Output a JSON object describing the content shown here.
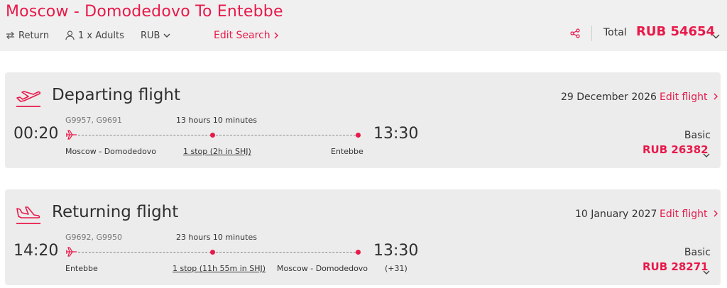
{
  "header": {
    "title": "Moscow - Domodedovo To Entebbe",
    "trip_type": "Return",
    "passengers": "1 x Adults",
    "currency": "RUB",
    "edit_search": "Edit Search",
    "total_label": "Total",
    "total_value": "RUB 54654"
  },
  "departing": {
    "title": "Departing flight",
    "date": "29 December 2026",
    "edit": "Edit flight",
    "flight_numbers": "G9957, G9691",
    "duration": "13 hours 10 minutes",
    "dep_time": "00:20",
    "arr_time": "13:30",
    "origin": "Moscow - Domodedovo",
    "stops": "1 stop (2h in SHJ)",
    "destination": "Entebbe",
    "fare_class": "Basic",
    "price": "RUB 26382"
  },
  "returning": {
    "title": "Returning flight",
    "date": "10 January 2027",
    "edit": "Edit flight",
    "flight_numbers": "G9692, G9950",
    "duration": "23 hours 10 minutes",
    "dep_time": "14:20",
    "arr_time": "13:30",
    "origin": "Entebbe",
    "stops": "1 stop (11h 55m in SHJ)",
    "destination": "Moscow - Domodedovo",
    "day_offset": "(+31)",
    "fare_class": "Basic",
    "price": "RUB 28271"
  },
  "colors": {
    "accent": "#e8194a",
    "card_bg": "#ececec",
    "header_bg": "#f0f0f0"
  },
  "icons": [
    "swap-icon",
    "person-icon",
    "chevron-down-icon",
    "chevron-right-icon",
    "share-icon",
    "takeoff-icon",
    "landing-icon",
    "plane-icon"
  ]
}
